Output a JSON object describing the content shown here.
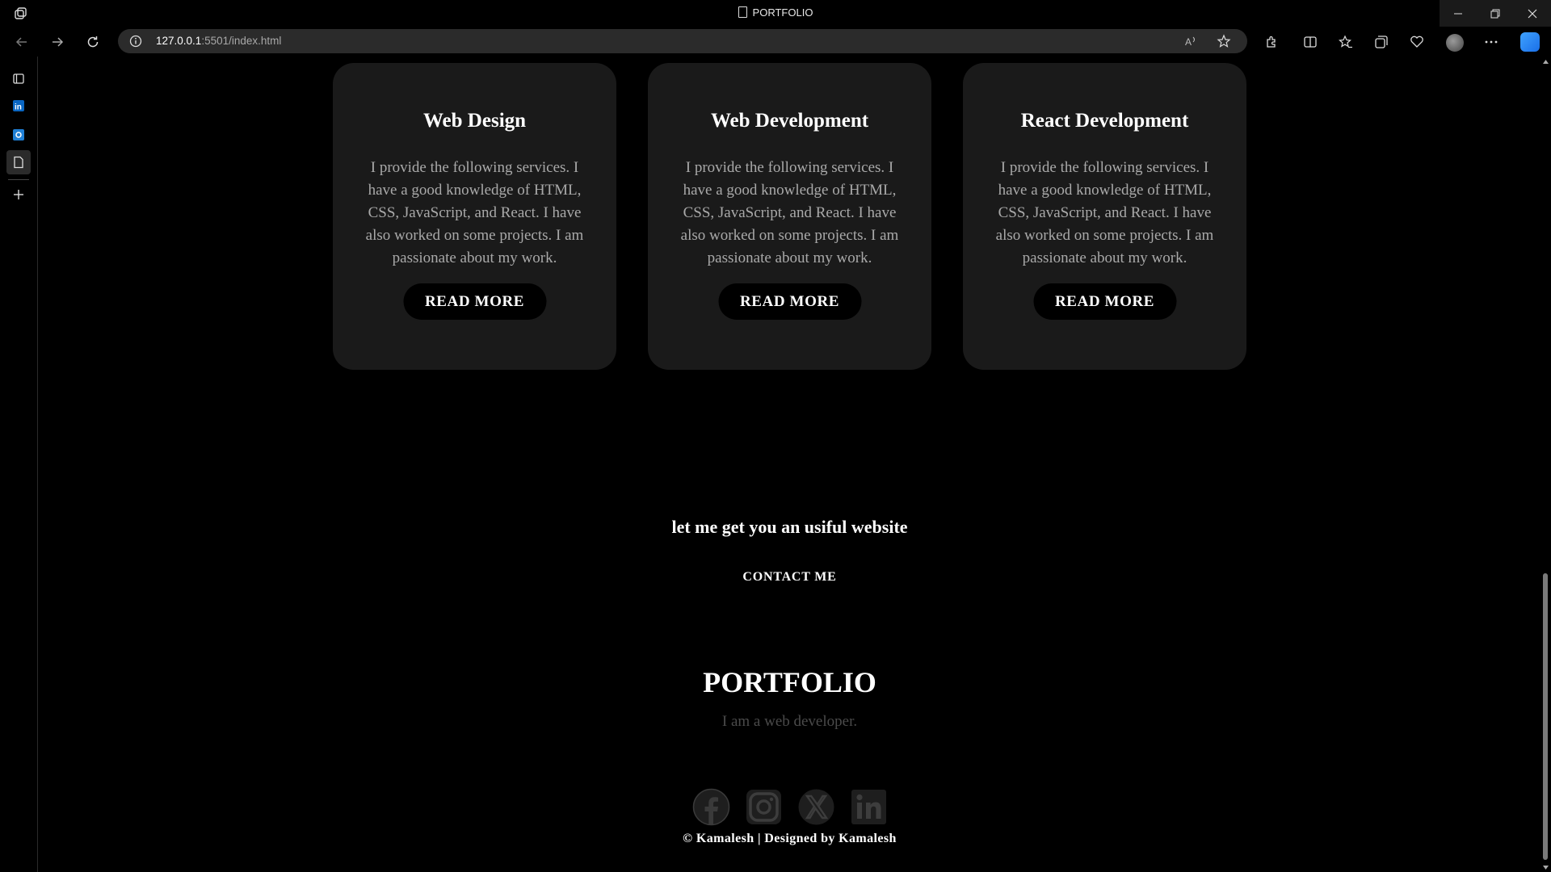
{
  "browser": {
    "tab_title": "PORTFOLIO",
    "url_host": "127.0.0.1",
    "url_rest": ":5501/index.html"
  },
  "services": [
    {
      "title": "Web Design",
      "description": "I provide the following services. I have a good knowledge of HTML, CSS, JavaScript, and React. I have also worked on some projects. I am passionate about my work.",
      "button": "READ MORE"
    },
    {
      "title": "Web Development",
      "description": "I provide the following services. I have a good knowledge of HTML, CSS, JavaScript, and React. I have also worked on some projects. I am passionate about my work.",
      "button": "READ MORE"
    },
    {
      "title": "React Development",
      "description": "I provide the following services. I have a good knowledge of HTML, CSS, JavaScript, and React. I have also worked on some projects. I am passionate about my work.",
      "button": "READ MORE"
    }
  ],
  "cta": {
    "tagline": "let me get you an usiful website",
    "contact_label": "CONTACT ME"
  },
  "footer": {
    "title": "PORTFOLIO",
    "subtitle": "I am a web developer.",
    "socials": [
      "facebook-icon",
      "instagram-icon",
      "x-twitter-icon",
      "linkedin-icon"
    ],
    "copyright": "© Kamalesh | Designed by Kamalesh"
  },
  "colors": {
    "background": "#000000",
    "card": "#1a1a1a",
    "muted_text": "#a9a9a9",
    "subtitle_text": "#4a4a4a"
  }
}
